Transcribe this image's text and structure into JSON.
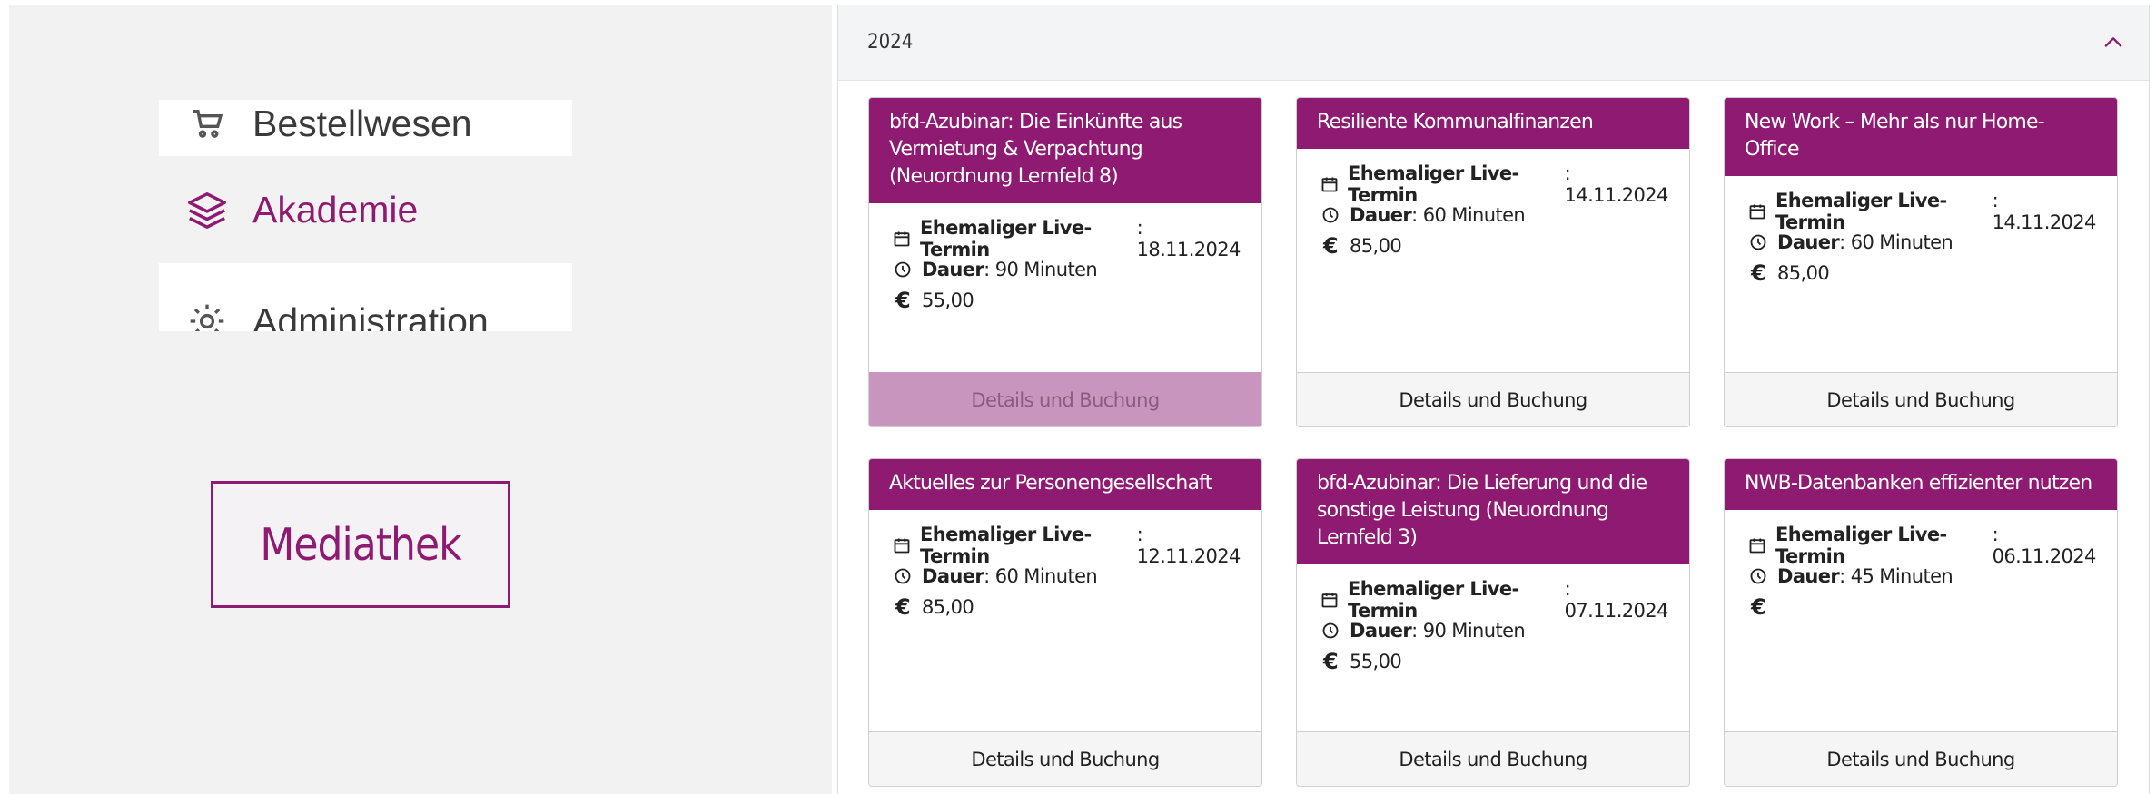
{
  "sidebar": {
    "items": [
      {
        "label": "Bestellwesen",
        "icon": "cart-icon"
      },
      {
        "label": "Akademie",
        "icon": "layers-icon",
        "active": true
      },
      {
        "label": "Administration",
        "icon": "gear-icon"
      }
    ],
    "mediathek_label": "Mediathek"
  },
  "accordion": {
    "title": "2024",
    "expanded": true
  },
  "labels": {
    "live_termin": "Ehemaliger Live-Termin",
    "dauer": "Dauer",
    "euro_symbol": "€",
    "details_button": "Details und Buchung"
  },
  "cards": [
    {
      "title": "bfd-Azubinar: Die Einkünfte aus Vermietung & Verpachtung (Neuordnung Lernfeld 8)",
      "date": ": 18.11.2024",
      "duration": ": 90 Minuten",
      "price": "55,00",
      "button_disabled": true
    },
    {
      "title": "Resiliente Kommunalfinanzen",
      "date": ": 14.11.2024",
      "duration": ": 60 Minuten",
      "price": "85,00",
      "button_disabled": false
    },
    {
      "title": "New Work – Mehr als nur Home-Office",
      "date": ": 14.11.2024",
      "duration": ": 60 Minuten",
      "price": "85,00",
      "button_disabled": false
    },
    {
      "title": "Aktuelles zur Personengesellschaft",
      "date": ": 12.11.2024",
      "duration": ": 60 Minuten",
      "price": "85,00",
      "button_disabled": false
    },
    {
      "title": "bfd-Azubinar: Die Lieferung und die sonstige Leistung (Neuordnung Lernfeld 3)",
      "date": ": 07.11.2024",
      "duration": ": 90 Minuten",
      "price": "55,00",
      "button_disabled": false
    },
    {
      "title": "NWB-Datenbanken effizienter nutzen",
      "date": ": 06.11.2024",
      "duration": ": 45 Minuten",
      "price": "",
      "button_disabled": false
    }
  ],
  "colors": {
    "brand": "#8e1a72",
    "disabled_button": "#c795bd"
  }
}
